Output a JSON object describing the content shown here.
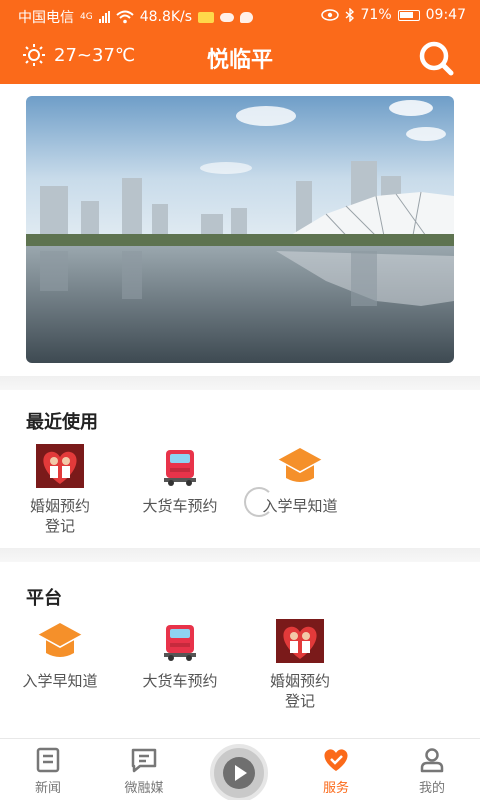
{
  "status_bar": {
    "carrier": "中国电信",
    "network": "4G",
    "speed": "48.8K/s",
    "battery": "71%",
    "time": "09:47"
  },
  "header": {
    "weather": "27~37℃",
    "title": "悦临平",
    "search_icon": "search-icon"
  },
  "recent": {
    "title": "最近使用",
    "apps": [
      {
        "label": "婚姻预约登记",
        "icon": "wedding-couple-icon"
      },
      {
        "label": "大货车预约",
        "icon": "truck-icon"
      },
      {
        "label": "入学早知道",
        "icon": "graduation-cap-icon"
      }
    ]
  },
  "platform": {
    "title": "平台",
    "apps": [
      {
        "label": "入学早知道",
        "icon": "graduation-cap-icon"
      },
      {
        "label": "大货车预约",
        "icon": "truck-icon"
      },
      {
        "label": "婚姻预约登记",
        "icon": "wedding-couple-icon"
      }
    ]
  },
  "bottom_nav": {
    "tabs": [
      {
        "label": "新闻",
        "icon": "news-icon"
      },
      {
        "label": "微融媒",
        "icon": "chat-icon"
      },
      {
        "label": "服务",
        "icon": "service-heart-icon",
        "active": true
      },
      {
        "label": "我的",
        "icon": "user-icon"
      }
    ]
  },
  "colors": {
    "accent": "#fb6a1a",
    "muted": "#777777"
  }
}
